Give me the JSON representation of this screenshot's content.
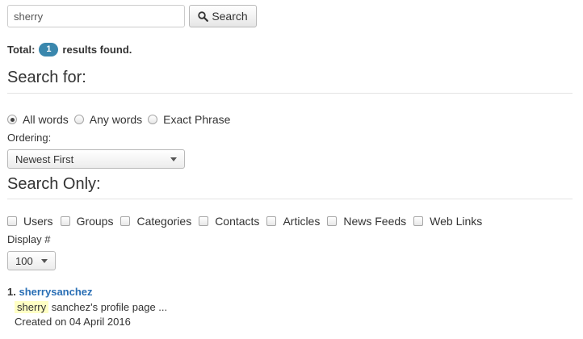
{
  "search": {
    "value": "sherry",
    "button_label": "Search",
    "button_icon": "search-icon"
  },
  "total": {
    "prefix": "Total:",
    "count": "1",
    "suffix": "results found.",
    "badge_color": "#3a87ad"
  },
  "search_for": {
    "title": "Search for:",
    "options": [
      {
        "label": "All words",
        "checked": true
      },
      {
        "label": "Any words",
        "checked": false
      },
      {
        "label": "Exact Phrase",
        "checked": false
      }
    ]
  },
  "ordering": {
    "label": "Ordering:",
    "selected": "Newest First"
  },
  "search_only": {
    "title": "Search Only:",
    "areas": [
      {
        "label": "Users",
        "checked": false
      },
      {
        "label": "Groups",
        "checked": false
      },
      {
        "label": "Categories",
        "checked": false
      },
      {
        "label": "Contacts",
        "checked": false
      },
      {
        "label": "Articles",
        "checked": false
      },
      {
        "label": "News Feeds",
        "checked": false
      },
      {
        "label": "Web Links",
        "checked": false
      }
    ]
  },
  "display": {
    "label": "Display #",
    "selected": "100"
  },
  "results": [
    {
      "number": "1.",
      "title": "sherrysanchez",
      "highlight": "sherry",
      "text_rest": " sanchez's profile page ...",
      "created": "Created on 04 April 2016"
    }
  ],
  "colors": {
    "link": "#2a6fb5",
    "highlight": "#ffffc4"
  }
}
